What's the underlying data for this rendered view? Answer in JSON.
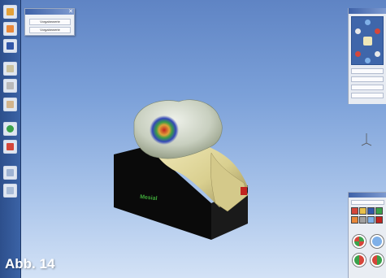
{
  "caption": "Abb. 14",
  "tool_panel": {
    "buttons": [
      "Vorgabewerte",
      "Vorgabewerte"
    ]
  },
  "model": {
    "base_label": "Mesial",
    "label_color": "#3fa83a"
  },
  "colors": {
    "background_top": "#5f84c4",
    "background_bottom": "#d3e2f6",
    "toolbar": "#3b63a6",
    "crown": "#cfd6c2",
    "die": "#e8e0a8",
    "base": "#0a0a0a",
    "contact_red": "#c0241f",
    "contact_blue": "#3347b8"
  },
  "icons": {
    "left_toolbar": [
      "home-icon",
      "color-icon",
      "save-icon",
      "layers-icon",
      "grid-icon",
      "measure-icon",
      "cross-section-icon",
      "color-map-icon",
      "zoom-icon",
      "settings-icon"
    ],
    "panel_close": "close-icon"
  }
}
